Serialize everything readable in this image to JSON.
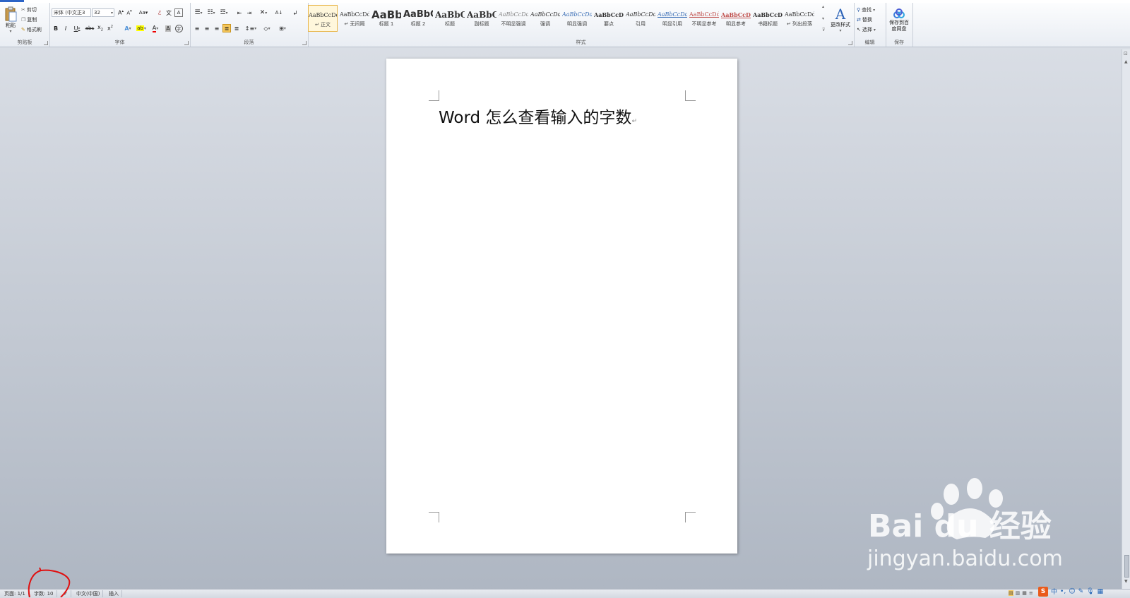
{
  "ribbon": {
    "clipboard": {
      "paste": "粘贴",
      "cut": "剪切",
      "copy": "复制",
      "format_painter": "格式刷",
      "label": "剪贴板"
    },
    "font": {
      "font_name": "宋体 (中文正3",
      "font_size": "32",
      "label": "字体"
    },
    "paragraph": {
      "label": "段落"
    },
    "styles": {
      "label": "样式",
      "items": [
        {
          "sample": "AaBbCcDd",
          "name": "↵ 正文"
        },
        {
          "sample": "AaBbCcDd",
          "name": "↵ 无间隔"
        },
        {
          "sample": "AaBb",
          "name": "标题 1"
        },
        {
          "sample": "AaBbC",
          "name": "标题 2"
        },
        {
          "sample": "AaBbC",
          "name": "标题"
        },
        {
          "sample": "AaBbC",
          "name": "副标题"
        },
        {
          "sample": "AaBbCcDd",
          "name": "不明显强调"
        },
        {
          "sample": "AaBbCcDd",
          "name": "强调"
        },
        {
          "sample": "AaBbCcDd",
          "name": "明显强调"
        },
        {
          "sample": "AaBbCcDd",
          "name": "要点"
        },
        {
          "sample": "AaBbCcDd",
          "name": "引用"
        },
        {
          "sample": "AaBbCcDd",
          "name": "明显引用"
        },
        {
          "sample": "AaBbCcDd",
          "name": "不明显参考"
        },
        {
          "sample": "AaBbCcDd",
          "name": "明显参考"
        },
        {
          "sample": "AaBbCcDd",
          "name": "书籍标题"
        },
        {
          "sample": "AaBbCcDd",
          "name": "↵ 列出段落"
        }
      ],
      "change_styles": "更改样式"
    },
    "editing": {
      "find": "查找",
      "replace": "替换",
      "select": "选择",
      "label": "编辑"
    },
    "save": {
      "save_to_baidu": "保存到百度网盘",
      "label": "保存"
    }
  },
  "document": {
    "text": "Word 怎么查看输入的字数",
    "paragraph_mark": "↵"
  },
  "statusbar": {
    "page": "页面: 1/1",
    "word_count": "字数: 10",
    "language": "中文(中国)",
    "insert_mode": "插入"
  },
  "watermark": {
    "brand": "Bai du 经验",
    "url": "jingyan.baidu.com"
  },
  "ime": {
    "mode": "中"
  },
  "colors": {
    "accent": "#2b63c6",
    "annotation": "#e01010",
    "selected_style_border": "#e8b64a"
  }
}
